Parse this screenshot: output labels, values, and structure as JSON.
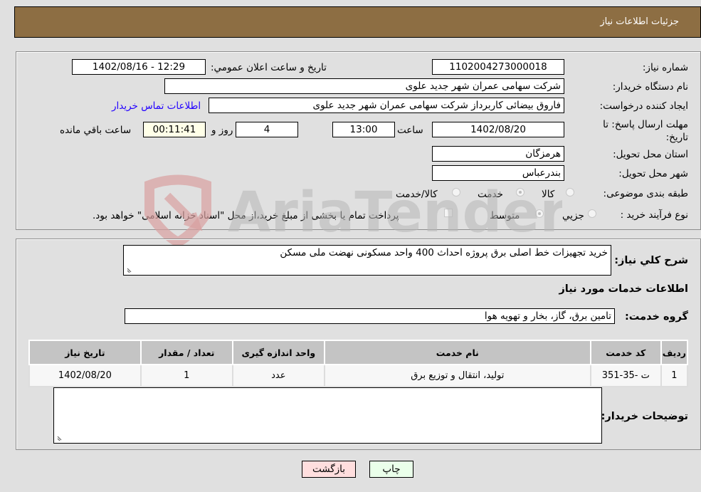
{
  "header": {
    "title": "جزئیات اطلاعات نیاز"
  },
  "form": {
    "need_number": {
      "label": "شماره نیاز:",
      "value": "1102004273000018"
    },
    "announce_datetime": {
      "label": "تاریخ و ساعت اعلان عمومي:",
      "value": "1402/08/16 - 12:29"
    },
    "buyer_org": {
      "label": "نام دستگاه خریدار:",
      "value": "شرکت سهامی عمران شهر جدید علوی"
    },
    "requester": {
      "label": "ایجاد کننده درخواست:",
      "value": "فاروق  بیضائی کاربرداز شرکت سهامی عمران شهر جدید علوی"
    },
    "buyer_contact_link": "اطلاعات تماس خریدار",
    "deadline": {
      "label": "مهلت ارسال پاسخ: تا تاریخ:",
      "date": "1402/08/20",
      "time_label": "ساعت",
      "time": "13:00",
      "days": "4",
      "days_label": "روز و",
      "remaining": "00:11:41",
      "remaining_label": "ساعت باقي مانده"
    },
    "province": {
      "label": "استان محل تحویل:",
      "value": "هرمزگان"
    },
    "city": {
      "label": "شهر محل تحویل:",
      "value": "بندرعباس"
    },
    "category": {
      "label": "طبقه بندی موضوعی:",
      "options": [
        "کالا",
        "خدمت",
        "کالا/خدمت"
      ],
      "selected": "خدمت"
    },
    "purchase_type": {
      "label": "نوع فرآیند خرید :",
      "options": [
        "جزيي",
        "متوسط"
      ],
      "selected": "متوسط",
      "treasury_note": "پرداخت تمام یا بخشی از مبلغ خرید،از محل \"اسناد خزانه اسلامی\" خواهد بود."
    }
  },
  "details": {
    "description_label": "شرح کلي نیاز:",
    "description": "خرید تجهیزات خط اصلی برق پروژه احداث 400 واحد مسکونی نهضت ملی مسکن",
    "services_heading": "اطلاعات خدمات مورد نیاز",
    "service_group_label": "گروه خدمت:",
    "service_group": "تامین برق، گاز، بخار و تهویه هوا",
    "table": {
      "headers": [
        "ردیف",
        "کد خدمت",
        "نام خدمت",
        "واحد اندازه گیری",
        "تعداد / مقدار",
        "تاریخ نیاز"
      ],
      "rows": [
        [
          "1",
          "ت -35-351",
          "تولید، انتقال و توزیع برق",
          "عدد",
          "1",
          "1402/08/20"
        ]
      ]
    },
    "buyer_notes_label": "توضیحات خریدار:",
    "buyer_notes": ""
  },
  "buttons": {
    "print": "چاپ",
    "back": "بازگشت"
  },
  "watermark": {
    "text": "AriaTender.neT"
  },
  "colors": {
    "header_bg": "#8d6e43",
    "print_bg": "#eaffea",
    "back_bg": "#ffdede",
    "link": "#2200ff"
  }
}
